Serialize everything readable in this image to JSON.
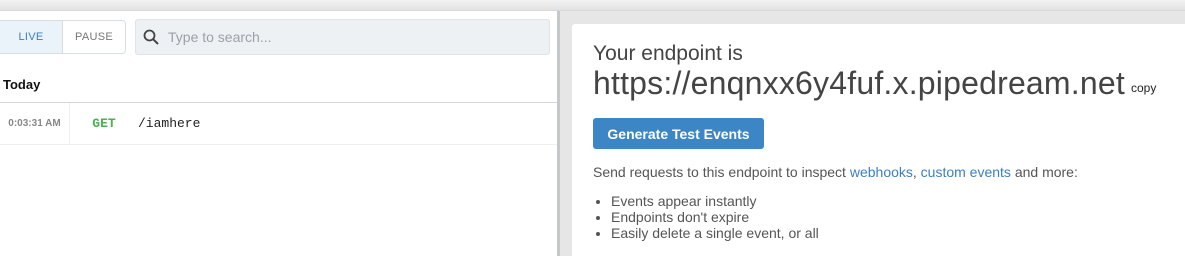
{
  "stream": {
    "live_label": "LIVE",
    "pause_label": "PAUSE",
    "search_placeholder": "Type to search...",
    "section_heading": "Today",
    "events": [
      {
        "time": "0:03:31 AM",
        "method": "GET",
        "path": "/iamhere"
      }
    ]
  },
  "endpoint_panel": {
    "label": "Your endpoint is",
    "url": "https://enqnxx6y4fuf.x.pipedream.net",
    "copy_label": "copy",
    "generate_button": "Generate Test Events",
    "desc_prefix": "Send requests to this endpoint to inspect ",
    "link_webhooks": "webhooks",
    "desc_comma": ", ",
    "link_custom_events": "custom events",
    "desc_suffix": " and more:",
    "features": [
      "Events appear instantly",
      "Endpoints don't expire",
      "Easily delete a single event, or all"
    ]
  },
  "colors": {
    "accent": "#3d86c6",
    "method_get": "#4caf50",
    "right_background": "#e6e6e6"
  },
  "icons": {
    "search": "search-icon"
  }
}
